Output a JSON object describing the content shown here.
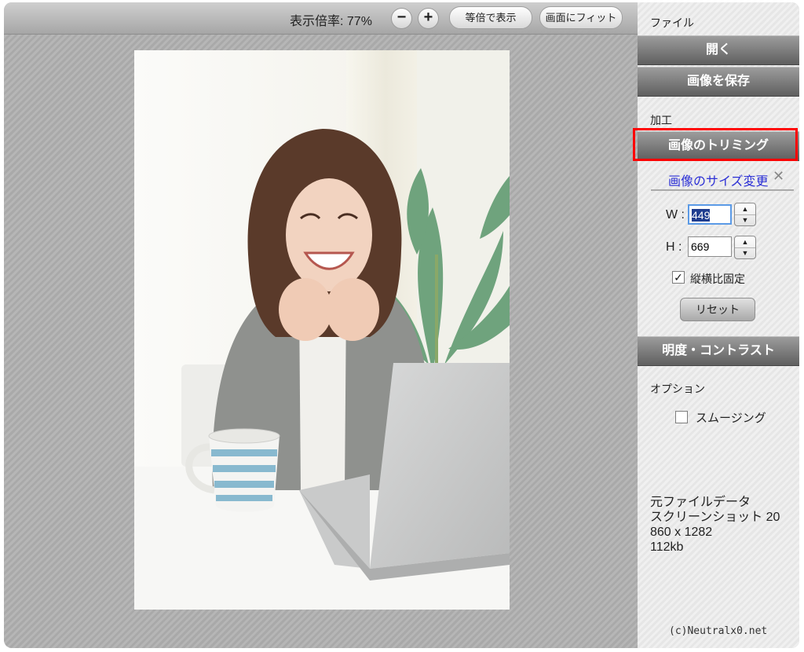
{
  "toolbar": {
    "zoom_label": "表示倍率: 77%",
    "zoom_out": "−",
    "zoom_in": "+",
    "actual_size": "等倍で表示",
    "fit": "画面にフィット"
  },
  "sidebar": {
    "file_section": "ファイル",
    "open": "開く",
    "save": "画像を保存",
    "process_section": "加工",
    "trim": "画像のトリミング",
    "resize_title": "画像のサイズ変更",
    "close_glyph": "✕",
    "w_label": "W :",
    "w_value": "449",
    "h_label": "H :",
    "h_value": "669",
    "keep_ratio_label": "縦横比固定",
    "keep_ratio_checked": true,
    "reset": "リセット",
    "brightness": "明度・コントラスト",
    "options_section": "オプション",
    "smoothing_label": "スムージング",
    "smoothing_checked": false,
    "source_info": [
      "元ファイルデータ",
      "スクリーンショット 20",
      "860 x 1282",
      "112kb"
    ],
    "copyright": "(c)Neutralx0.net"
  },
  "colors": {
    "highlight": "#ff0000",
    "link": "#2d31d6",
    "menu_button": "#7a7a7a"
  },
  "icons": {
    "zoom_out": "minus-icon",
    "zoom_in": "plus-icon",
    "close": "close-icon",
    "checkbox": "checkmark-icon"
  }
}
